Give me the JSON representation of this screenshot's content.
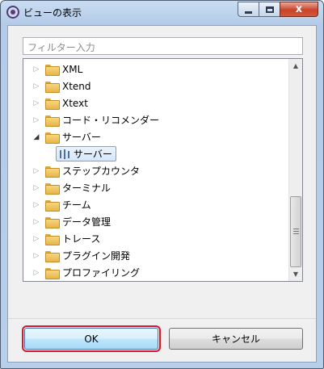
{
  "window": {
    "title": "ビューの表示",
    "close_label": "x"
  },
  "filter": {
    "placeholder": "フィルター入力"
  },
  "tree": {
    "items": [
      {
        "label": "XML",
        "expanded": false
      },
      {
        "label": "Xtend",
        "expanded": false
      },
      {
        "label": "Xtext",
        "expanded": false
      },
      {
        "label": "コード・リコメンダー",
        "expanded": false
      },
      {
        "label": "サーバー",
        "expanded": true
      },
      {
        "label": "ステップカウンタ",
        "expanded": false
      },
      {
        "label": "ターミナル",
        "expanded": false
      },
      {
        "label": "チーム",
        "expanded": false
      },
      {
        "label": "データ管理",
        "expanded": false
      },
      {
        "label": "トレース",
        "expanded": false
      },
      {
        "label": "プラグイン開発",
        "expanded": false
      },
      {
        "label": "プロファイリング",
        "expanded": false
      }
    ],
    "selected_child": {
      "label": "サーバー",
      "icon": "server-view-icon"
    }
  },
  "buttons": {
    "ok_label": "OK",
    "cancel_label": "キャンセル"
  },
  "colors": {
    "focus_outline": "#e0142a",
    "selection": "#d6e7fb",
    "folder": "#e8b448"
  }
}
